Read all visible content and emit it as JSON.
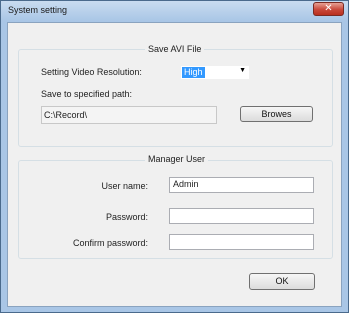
{
  "window": {
    "title": "System setting",
    "close_glyph": "✕"
  },
  "save_avi": {
    "group_title": "Save AVI File",
    "resolution_label": "Setting Video Resolution:",
    "resolution_value": "High",
    "path_label": "Save to specified path:",
    "path_value": "C:\\Record\\",
    "browse_label": "Browes"
  },
  "manager_user": {
    "group_title": "Manager User",
    "username_label": "User name:",
    "username_value": "Admin",
    "password_label": "Password:",
    "password_value": "",
    "confirm_label": "Confirm password:",
    "confirm_value": ""
  },
  "footer": {
    "ok_label": "OK"
  },
  "icons": {
    "dropdown": "chevron-down-icon",
    "close": "close-icon"
  },
  "colors": {
    "selection": "#3399ff",
    "window_frame": "#a9c6e6",
    "close_button": "#c9483a"
  }
}
